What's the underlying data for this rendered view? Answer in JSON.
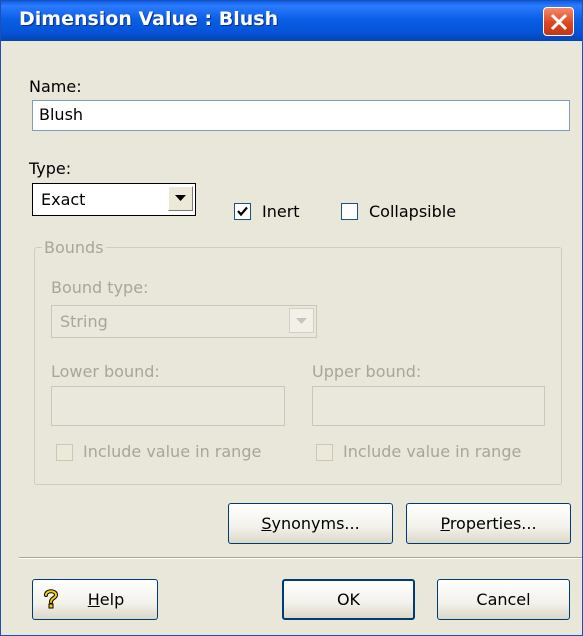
{
  "window": {
    "title": "Dimension Value :  Blush"
  },
  "name_field": {
    "label": "Name:",
    "value": "Blush"
  },
  "type_field": {
    "label": "Type:",
    "value": "Exact"
  },
  "inert": {
    "label": "Inert",
    "checked": true
  },
  "collapsible": {
    "label": "Collapsible",
    "checked": false
  },
  "bounds": {
    "title": "Bounds",
    "bound_type_label": "Bound type:",
    "bound_type_value": "String",
    "lower_label": "Lower bound:",
    "upper_label": "Upper bound:",
    "lower_value": "",
    "upper_value": "",
    "lower_include_label": "Include value in range",
    "upper_include_label": "Include value in range"
  },
  "buttons": {
    "synonyms_u": "S",
    "synonyms_rest": "ynonyms...",
    "properties_u": "P",
    "properties_rest": "roperties...",
    "help_u": "H",
    "help_rest": "elp",
    "ok": "OK",
    "cancel": "Cancel"
  },
  "icons": {
    "close": "close-icon",
    "help": "help-icon",
    "dropdown": "chevron-down-icon",
    "check": "checkmark-icon"
  },
  "colors": {
    "titlebar": "#0a5fe6",
    "close": "#dd4722",
    "face": "#e9e6da",
    "disabled_text": "#a8a59a"
  }
}
